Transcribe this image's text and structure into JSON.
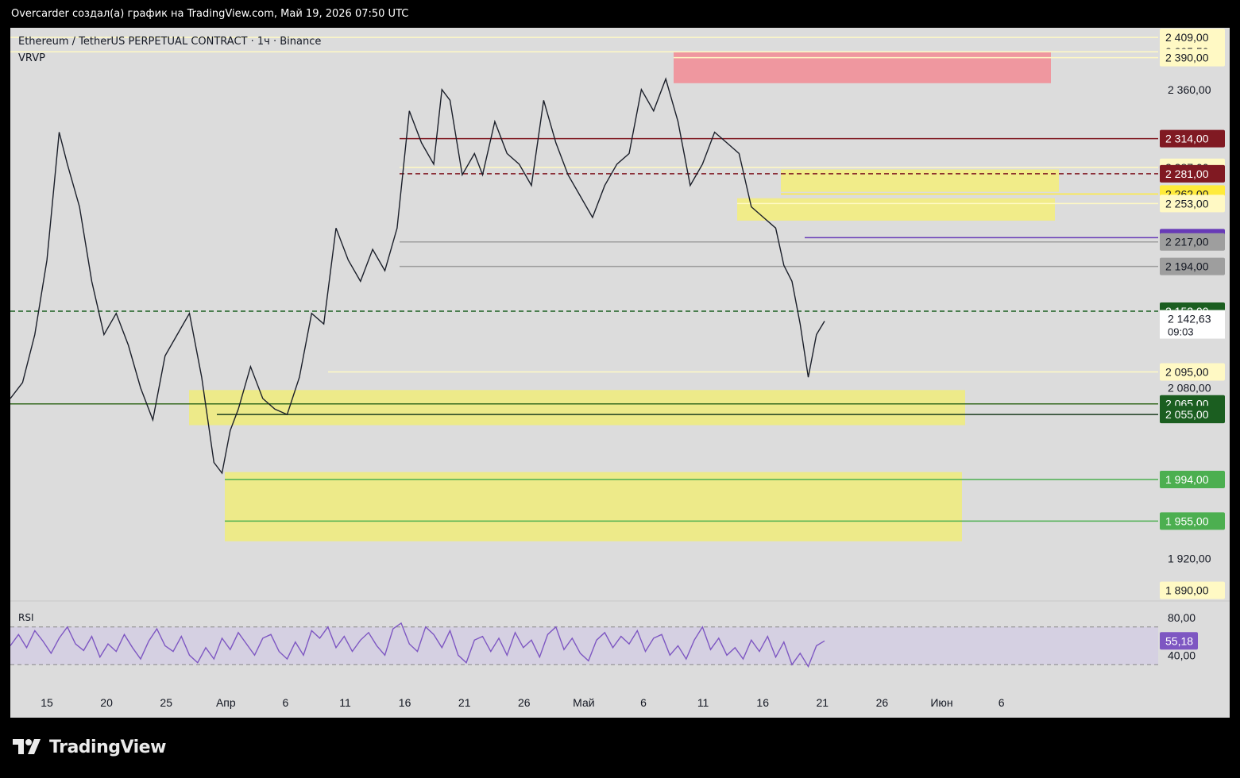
{
  "caption": "Overcarder создал(а) график на TradingView.com, Май 19, 2026 07:50 UTC",
  "brand": {
    "logo_text": "TradingView"
  },
  "chart_data": [
    {
      "type": "candlestick",
      "title": "Ethereum / TetherUS PERPETUAL CONTRACT · 1ч · Binance",
      "indicator": "VRVP",
      "x_ticks": [
        "15",
        "20",
        "25",
        "Апр",
        "6",
        "11",
        "16",
        "21",
        "26",
        "Май",
        "6",
        "11",
        "16",
        "21",
        "26",
        "Июн",
        "6"
      ],
      "y_ticks": [
        "2 360,00",
        "2 080,00",
        "1 920,00"
      ],
      "ylim": [
        1880,
        2418
      ],
      "last_price": {
        "value": "2 142,63",
        "countdown": "09:03",
        "price": 2142.63
      },
      "price_path": [
        [
          0,
          2070
        ],
        [
          3,
          2085
        ],
        [
          6,
          2130
        ],
        [
          9,
          2200
        ],
        [
          12,
          2320
        ],
        [
          14,
          2290
        ],
        [
          17,
          2250
        ],
        [
          20,
          2180
        ],
        [
          23,
          2130
        ],
        [
          26,
          2150
        ],
        [
          29,
          2120
        ],
        [
          32,
          2080
        ],
        [
          35,
          2050
        ],
        [
          38,
          2110
        ],
        [
          41,
          2130
        ],
        [
          44,
          2150
        ],
        [
          47,
          2090
        ],
        [
          50,
          2010
        ],
        [
          52,
          2000
        ],
        [
          54,
          2040
        ],
        [
          56,
          2060
        ],
        [
          59,
          2100
        ],
        [
          62,
          2070
        ],
        [
          65,
          2060
        ],
        [
          68,
          2055
        ],
        [
          71,
          2090
        ],
        [
          74,
          2150
        ],
        [
          77,
          2140
        ],
        [
          80,
          2230
        ],
        [
          83,
          2200
        ],
        [
          86,
          2180
        ],
        [
          89,
          2210
        ],
        [
          92,
          2190
        ],
        [
          95,
          2230
        ],
        [
          98,
          2340
        ],
        [
          101,
          2310
        ],
        [
          104,
          2290
        ],
        [
          106,
          2360
        ],
        [
          108,
          2350
        ],
        [
          111,
          2280
        ],
        [
          114,
          2300
        ],
        [
          116,
          2280
        ],
        [
          119,
          2330
        ],
        [
          122,
          2300
        ],
        [
          125,
          2290
        ],
        [
          128,
          2270
        ],
        [
          131,
          2350
        ],
        [
          134,
          2310
        ],
        [
          137,
          2280
        ],
        [
          140,
          2260
        ],
        [
          143,
          2240
        ],
        [
          146,
          2270
        ],
        [
          149,
          2290
        ],
        [
          152,
          2300
        ],
        [
          155,
          2360
        ],
        [
          158,
          2340
        ],
        [
          161,
          2370
        ],
        [
          164,
          2330
        ],
        [
          167,
          2270
        ],
        [
          170,
          2290
        ],
        [
          173,
          2320
        ],
        [
          176,
          2310
        ],
        [
          179,
          2300
        ],
        [
          182,
          2250
        ],
        [
          185,
          2240
        ],
        [
          188,
          2230
        ],
        [
          190,
          2195
        ],
        [
          192,
          2180
        ],
        [
          194,
          2140
        ],
        [
          196,
          2090
        ],
        [
          198,
          2130
        ],
        [
          200,
          2142.63
        ]
      ],
      "horizontal_lines": [
        {
          "price": 2409,
          "label": "2 409,00",
          "bg": "#fff9c4",
          "fg": "#131722",
          "line": "#fff9c4",
          "style": "solid"
        },
        {
          "price": 2395.5,
          "label": "2 395,50",
          "bg": "#fff9c4",
          "fg": "#131722",
          "line": "#fff9c4",
          "style": "solid"
        },
        {
          "price": 2390,
          "label": "2 390,00",
          "bg": "#fff9c4",
          "fg": "#131722",
          "line": "#fff9c4",
          "style": "solid"
        },
        {
          "price": 2314,
          "label": "2 314,00",
          "bg": "#801922",
          "fg": "#ffffff",
          "line": "#801922",
          "style": "solid"
        },
        {
          "price": 2287,
          "label": "2 287,00",
          "bg": "#fff9c4",
          "fg": "#131722",
          "line": "#fff9c4",
          "style": "solid"
        },
        {
          "price": 2281,
          "label": "2 281,00",
          "bg": "#801922",
          "fg": "#ffffff",
          "line": "#801922",
          "style": "dashed"
        },
        {
          "price": 2262,
          "label": "2 262,00",
          "bg": "#ffeb3b",
          "fg": "#131722",
          "line": "#ffeb3b",
          "style": "solid"
        },
        {
          "price": 2253,
          "label": "2 253,00",
          "bg": "#fff9c4",
          "fg": "#131722",
          "line": "#fff9c4",
          "style": "solid"
        },
        {
          "price": 2221,
          "label": "2 221,00",
          "bg": "#673ab7",
          "fg": "#ffffff",
          "line": "#673ab7",
          "style": "solid"
        },
        {
          "price": 2217,
          "label": "2 217,00",
          "bg": "#9e9e9e",
          "fg": "#131722",
          "line": "#9e9e9e",
          "style": "solid"
        },
        {
          "price": 2194,
          "label": "2 194,00",
          "bg": "#9e9e9e",
          "fg": "#131722",
          "line": "#9e9e9e",
          "style": "solid"
        },
        {
          "price": 2152,
          "label": "2 152,00",
          "bg": "#1b5e20",
          "fg": "#ffffff",
          "line": "#1b5e20",
          "style": "dashed"
        },
        {
          "price": 2095,
          "label": "2 095,00",
          "bg": "#fff9c4",
          "fg": "#131722",
          "line": "#fff9c4",
          "style": "solid"
        },
        {
          "price": 2065,
          "label": "2 065,00",
          "bg": "#1b5e20",
          "fg": "#ffffff",
          "line": "#33691e",
          "style": "solid"
        },
        {
          "price": 2055,
          "label": "2 055,00",
          "bg": "#1b5e20",
          "fg": "#ffffff",
          "line": "#1b3d1e",
          "style": "solid"
        },
        {
          "price": 1994,
          "label": "1 994,00",
          "bg": "#4caf50",
          "fg": "#ffffff",
          "line": "#4caf50",
          "style": "solid"
        },
        {
          "price": 1955,
          "label": "1 955,00",
          "bg": "#4caf50",
          "fg": "#ffffff",
          "line": "#4caf50",
          "style": "solid"
        },
        {
          "price": 1890,
          "label": "1 890,00",
          "bg": "#fff9c4",
          "fg": "#131722",
          "line": "#fff9c4",
          "style": "solid"
        }
      ],
      "zones": [
        {
          "from_price": 2366,
          "to_price": 2395,
          "color": "#f28b94"
        },
        {
          "from_price": 2264,
          "to_price": 2285,
          "color": "#f5ef7a"
        },
        {
          "from_price": 2237,
          "to_price": 2258,
          "color": "#f5ef7a"
        },
        {
          "from_price": 2045,
          "to_price": 2078,
          "color": "#f0ec7a"
        },
        {
          "from_price": 1936,
          "to_price": 2001,
          "color": "#f0ec7a"
        }
      ],
      "rsi": {
        "label": "RSI",
        "value": "55,18",
        "ticks": [
          "80,00",
          "40,00"
        ],
        "levels": [
          70,
          30
        ],
        "ylim": [
          15,
          95
        ],
        "series": [
          [
            0,
            50
          ],
          [
            2,
            62
          ],
          [
            4,
            48
          ],
          [
            6,
            66
          ],
          [
            8,
            55
          ],
          [
            10,
            42
          ],
          [
            12,
            58
          ],
          [
            14,
            70
          ],
          [
            16,
            52
          ],
          [
            18,
            45
          ],
          [
            20,
            60
          ],
          [
            22,
            38
          ],
          [
            24,
            52
          ],
          [
            26,
            44
          ],
          [
            28,
            62
          ],
          [
            30,
            48
          ],
          [
            32,
            36
          ],
          [
            34,
            55
          ],
          [
            36,
            68
          ],
          [
            38,
            50
          ],
          [
            40,
            44
          ],
          [
            42,
            60
          ],
          [
            44,
            40
          ],
          [
            46,
            32
          ],
          [
            48,
            48
          ],
          [
            50,
            36
          ],
          [
            52,
            58
          ],
          [
            54,
            46
          ],
          [
            56,
            64
          ],
          [
            58,
            52
          ],
          [
            60,
            40
          ],
          [
            62,
            58
          ],
          [
            64,
            62
          ],
          [
            66,
            44
          ],
          [
            68,
            36
          ],
          [
            70,
            54
          ],
          [
            72,
            40
          ],
          [
            74,
            66
          ],
          [
            76,
            58
          ],
          [
            78,
            70
          ],
          [
            80,
            48
          ],
          [
            82,
            60
          ],
          [
            84,
            44
          ],
          [
            86,
            56
          ],
          [
            88,
            64
          ],
          [
            90,
            50
          ],
          [
            92,
            40
          ],
          [
            94,
            68
          ],
          [
            96,
            74
          ],
          [
            98,
            52
          ],
          [
            100,
            44
          ],
          [
            102,
            70
          ],
          [
            104,
            62
          ],
          [
            106,
            48
          ],
          [
            108,
            66
          ],
          [
            110,
            40
          ],
          [
            112,
            32
          ],
          [
            114,
            56
          ],
          [
            116,
            60
          ],
          [
            118,
            44
          ],
          [
            120,
            58
          ],
          [
            122,
            40
          ],
          [
            124,
            64
          ],
          [
            126,
            48
          ],
          [
            128,
            56
          ],
          [
            130,
            38
          ],
          [
            132,
            62
          ],
          [
            134,
            70
          ],
          [
            136,
            46
          ],
          [
            138,
            58
          ],
          [
            140,
            42
          ],
          [
            142,
            34
          ],
          [
            144,
            56
          ],
          [
            146,
            64
          ],
          [
            148,
            48
          ],
          [
            150,
            60
          ],
          [
            152,
            52
          ],
          [
            154,
            66
          ],
          [
            156,
            44
          ],
          [
            158,
            58
          ],
          [
            160,
            62
          ],
          [
            162,
            40
          ],
          [
            164,
            50
          ],
          [
            166,
            36
          ],
          [
            168,
            56
          ],
          [
            170,
            70
          ],
          [
            172,
            46
          ],
          [
            174,
            58
          ],
          [
            176,
            40
          ],
          [
            178,
            48
          ],
          [
            180,
            36
          ],
          [
            182,
            56
          ],
          [
            184,
            44
          ],
          [
            186,
            60
          ],
          [
            188,
            38
          ],
          [
            190,
            54
          ],
          [
            192,
            30
          ],
          [
            194,
            42
          ],
          [
            196,
            28
          ],
          [
            198,
            50
          ],
          [
            200,
            55.18
          ]
        ]
      }
    }
  ]
}
